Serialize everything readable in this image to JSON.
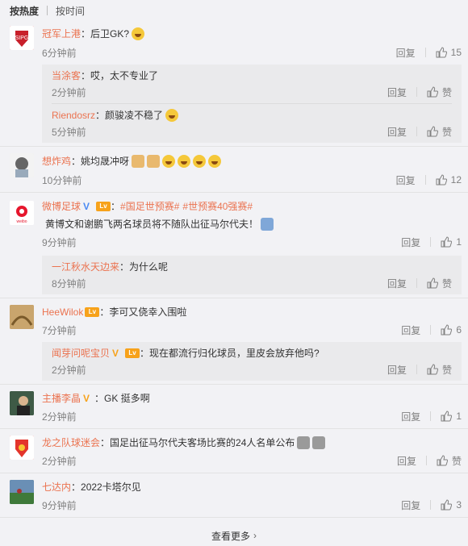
{
  "sort": {
    "hot": "按热度",
    "time": "按时间"
  },
  "labels": {
    "reply": "回复",
    "like": "赞",
    "more": "查看更多"
  },
  "comments": [
    {
      "name": "冠军上港",
      "text": "后卫GK?",
      "time": "6分钟前",
      "likes": "15"
    },
    {
      "name": "当涂客",
      "text": "哎，太不专业了",
      "time": "2分钟前"
    },
    {
      "name": "Riendosrz",
      "text": "颜骏凌不稳了",
      "time": "5分钟前"
    },
    {
      "name": "想炸鸡",
      "text": "姚均晟冲呀",
      "time": "10分钟前",
      "likes": "12"
    },
    {
      "name": "微博足球",
      "tag1": "#国足世预赛#",
      "tag2": "#世预赛40强赛#",
      "text": "黄博文和谢鹏飞两名球员将不随队出征马尔代夫！",
      "time": "9分钟前",
      "likes": "1"
    },
    {
      "name": "一江秋水天边来",
      "text": "为什么呢",
      "time": "8分钟前"
    },
    {
      "name": "HeeWilok",
      "text": "李可又侥幸入围啦",
      "time": "7分钟前",
      "likes": "6"
    },
    {
      "name": "闻芽问呢宝贝",
      "text": "现在都流行归化球员，里皮会放弃他吗?",
      "time": "2分钟前"
    },
    {
      "name": "主播李晶",
      "text": "GK 挺多啊",
      "time": "2分钟前",
      "likes": "1"
    },
    {
      "name": "龙之队球迷会",
      "text": "国足出征马尔代夫客场比赛的24人名单公布",
      "time": "2分钟前"
    },
    {
      "name": "七达内",
      "text": "2022卡塔尔见",
      "time": "9分钟前",
      "likes": "3"
    }
  ],
  "colors": {
    "accent": "#eb7350",
    "bg": "#f2f2f5",
    "vip": "#4b8af3"
  }
}
